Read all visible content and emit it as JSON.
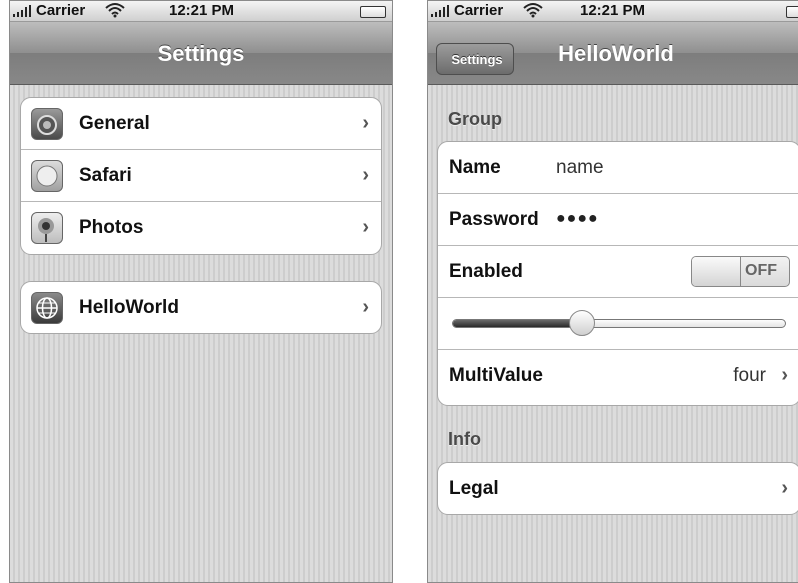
{
  "status_bar": {
    "carrier": "Carrier",
    "time": "12:21 PM"
  },
  "left_screen": {
    "nav_title": "Settings",
    "groups": [
      [
        {
          "label": "General",
          "icon": "gear-icon"
        },
        {
          "label": "Safari",
          "icon": "compass-icon"
        },
        {
          "label": "Photos",
          "icon": "sunflower-icon"
        }
      ],
      [
        {
          "label": "HelloWorld",
          "icon": "globe-icon"
        }
      ]
    ]
  },
  "right_screen": {
    "back_button": "Settings",
    "nav_title": "HelloWorld",
    "sections": [
      {
        "header": "Group",
        "rows": {
          "name": {
            "label": "Name",
            "value": "name"
          },
          "password": {
            "label": "Password",
            "value": "●●●●"
          },
          "enabled": {
            "label": "Enabled",
            "state": "OFF"
          },
          "slider": {
            "value": 0.39
          },
          "multivalue": {
            "label": "MultiValue",
            "value": "four"
          }
        }
      },
      {
        "header": "Info",
        "rows": {
          "legal": {
            "label": "Legal"
          }
        }
      }
    ]
  },
  "chevron": "›"
}
